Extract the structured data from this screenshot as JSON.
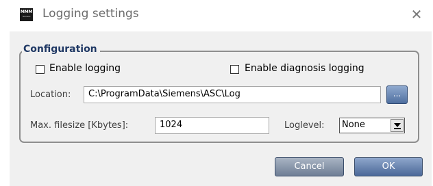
{
  "window": {
    "title": "Logging settings",
    "icon_text_main": "MMM",
    "icon_text_sub": "Siemens",
    "close_glyph": "✕"
  },
  "configuration": {
    "group_title": "Configuration",
    "enable_logging_label": "Enable logging",
    "enable_logging_checked": false,
    "enable_diagnosis_label": "Enable diagnosis logging",
    "enable_diagnosis_checked": false,
    "location_label": "Location:",
    "location_value": "C:\\ProgramData\\Siemens\\ASC\\Log",
    "browse_label": "...",
    "max_filesize_label": "Max. filesize [Kbytes]:",
    "max_filesize_value": "1024",
    "loglevel_label": "Loglevel:",
    "loglevel_value": "None"
  },
  "buttons": {
    "cancel_label": "Cancel",
    "ok_label": "OK"
  },
  "icons": {
    "app": "app-icon",
    "close": "close-icon",
    "dropdown": "chevron-down-icon"
  },
  "colors": {
    "group_title": "#1f3864",
    "button_ok": "#4b6898",
    "button_cancel": "#6f7e95",
    "client_bg": "#f0f0f0"
  }
}
